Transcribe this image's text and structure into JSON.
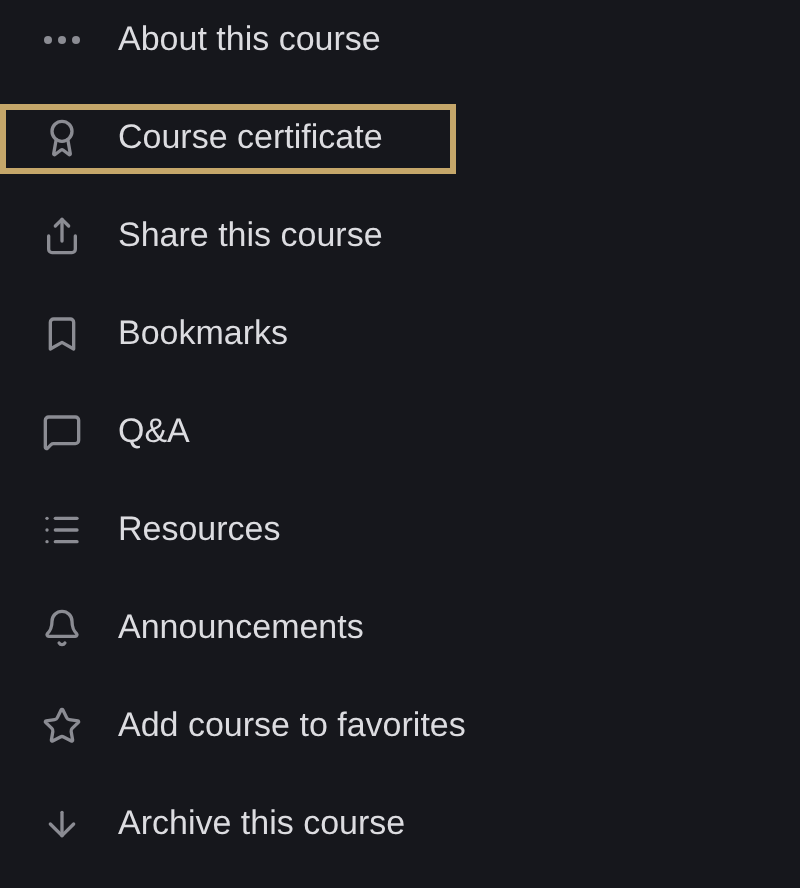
{
  "menu": {
    "items": [
      {
        "kind": "more",
        "label": "About this course",
        "selected": false
      },
      {
        "kind": "certificate",
        "label": "Course certificate",
        "selected": true
      },
      {
        "kind": "share",
        "label": "Share this course",
        "selected": false
      },
      {
        "kind": "bookmark",
        "label": "Bookmarks",
        "selected": false
      },
      {
        "kind": "qa",
        "label": "Q&A",
        "selected": false
      },
      {
        "kind": "resources",
        "label": "Resources",
        "selected": false
      },
      {
        "kind": "announcements",
        "label": "Announcements",
        "selected": false
      },
      {
        "kind": "favorite",
        "label": "Add course to favorites",
        "selected": false
      },
      {
        "kind": "archive",
        "label": "Archive this course",
        "selected": false
      }
    ]
  }
}
